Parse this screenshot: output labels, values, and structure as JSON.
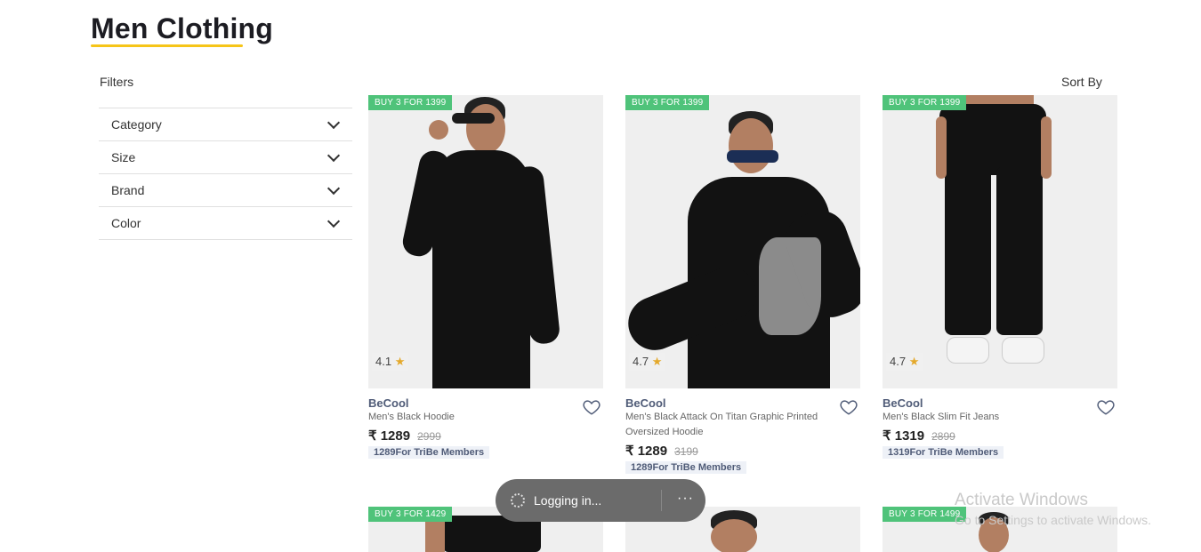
{
  "page": {
    "title": "Men Clothing",
    "filters_label": "Filters",
    "sort_label": "Sort By"
  },
  "filters": [
    {
      "label": "Category"
    },
    {
      "label": "Size"
    },
    {
      "label": "Brand"
    },
    {
      "label": "Color"
    }
  ],
  "products": [
    {
      "badge": "BUY 3 FOR 1399",
      "rating": "4.1",
      "brand": "BeCool",
      "name": "Men's Black Hoodie",
      "price": "₹ 1289",
      "mrp": "2999",
      "tribe": "1289For TriBe Members"
    },
    {
      "badge": "BUY 3 FOR 1399",
      "rating": "4.7",
      "brand": "BeCool",
      "name": "Men's Black Attack On Titan Graphic Printed Oversized Hoodie",
      "price": "₹ 1289",
      "mrp": "3199",
      "tribe": "1289For TriBe Members"
    },
    {
      "badge": "BUY 3 FOR 1399",
      "rating": "4.7",
      "brand": "BeCool",
      "name": "Men's Black Slim Fit Jeans",
      "price": "₹ 1319",
      "mrp": "2899",
      "tribe": "1319For TriBe Members"
    }
  ],
  "second_row": [
    {
      "badge": "BUY 3 FOR 1429"
    },
    {
      "badge": ""
    },
    {
      "badge": "BUY 3 FOR 1499"
    }
  ],
  "toast": {
    "text": "Logging in...",
    "more": "···"
  },
  "watermark": {
    "line1": "Activate Windows",
    "line2": "Go to Settings to activate Windows."
  },
  "colors": {
    "accent_underline": "#f6c518",
    "badge_green": "#4fc37a",
    "brand_text": "#4f5b77",
    "star": "#e4a92b"
  },
  "icons": {
    "filter_chevron": "chevron-down-icon",
    "wishlist": "heart-icon",
    "rating": "star-icon",
    "loading": "spinner-icon"
  }
}
